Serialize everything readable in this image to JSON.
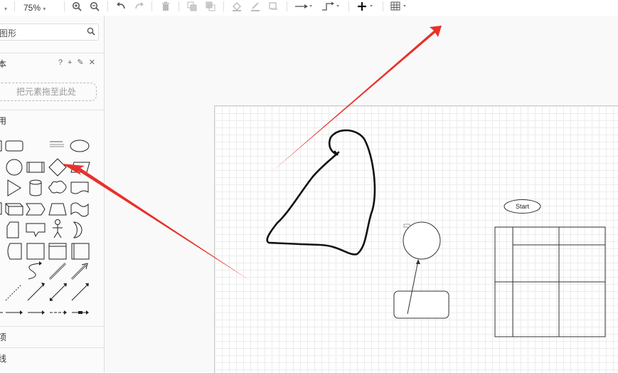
{
  "toolbar": {
    "zoom": "75%"
  },
  "sidebar": {
    "search_placeholder": "图形",
    "section_scratchpad": "本",
    "scratchpad_icons": "? + ✎ ✕",
    "dropzone_label": "把元素拖至此处",
    "section_general": "用",
    "section_misc": "项",
    "section_advanced": "线"
  },
  "canvas": {
    "start_label": "Start"
  },
  "colors": {
    "arrow": "#e8312a",
    "grid": "#ececec"
  }
}
